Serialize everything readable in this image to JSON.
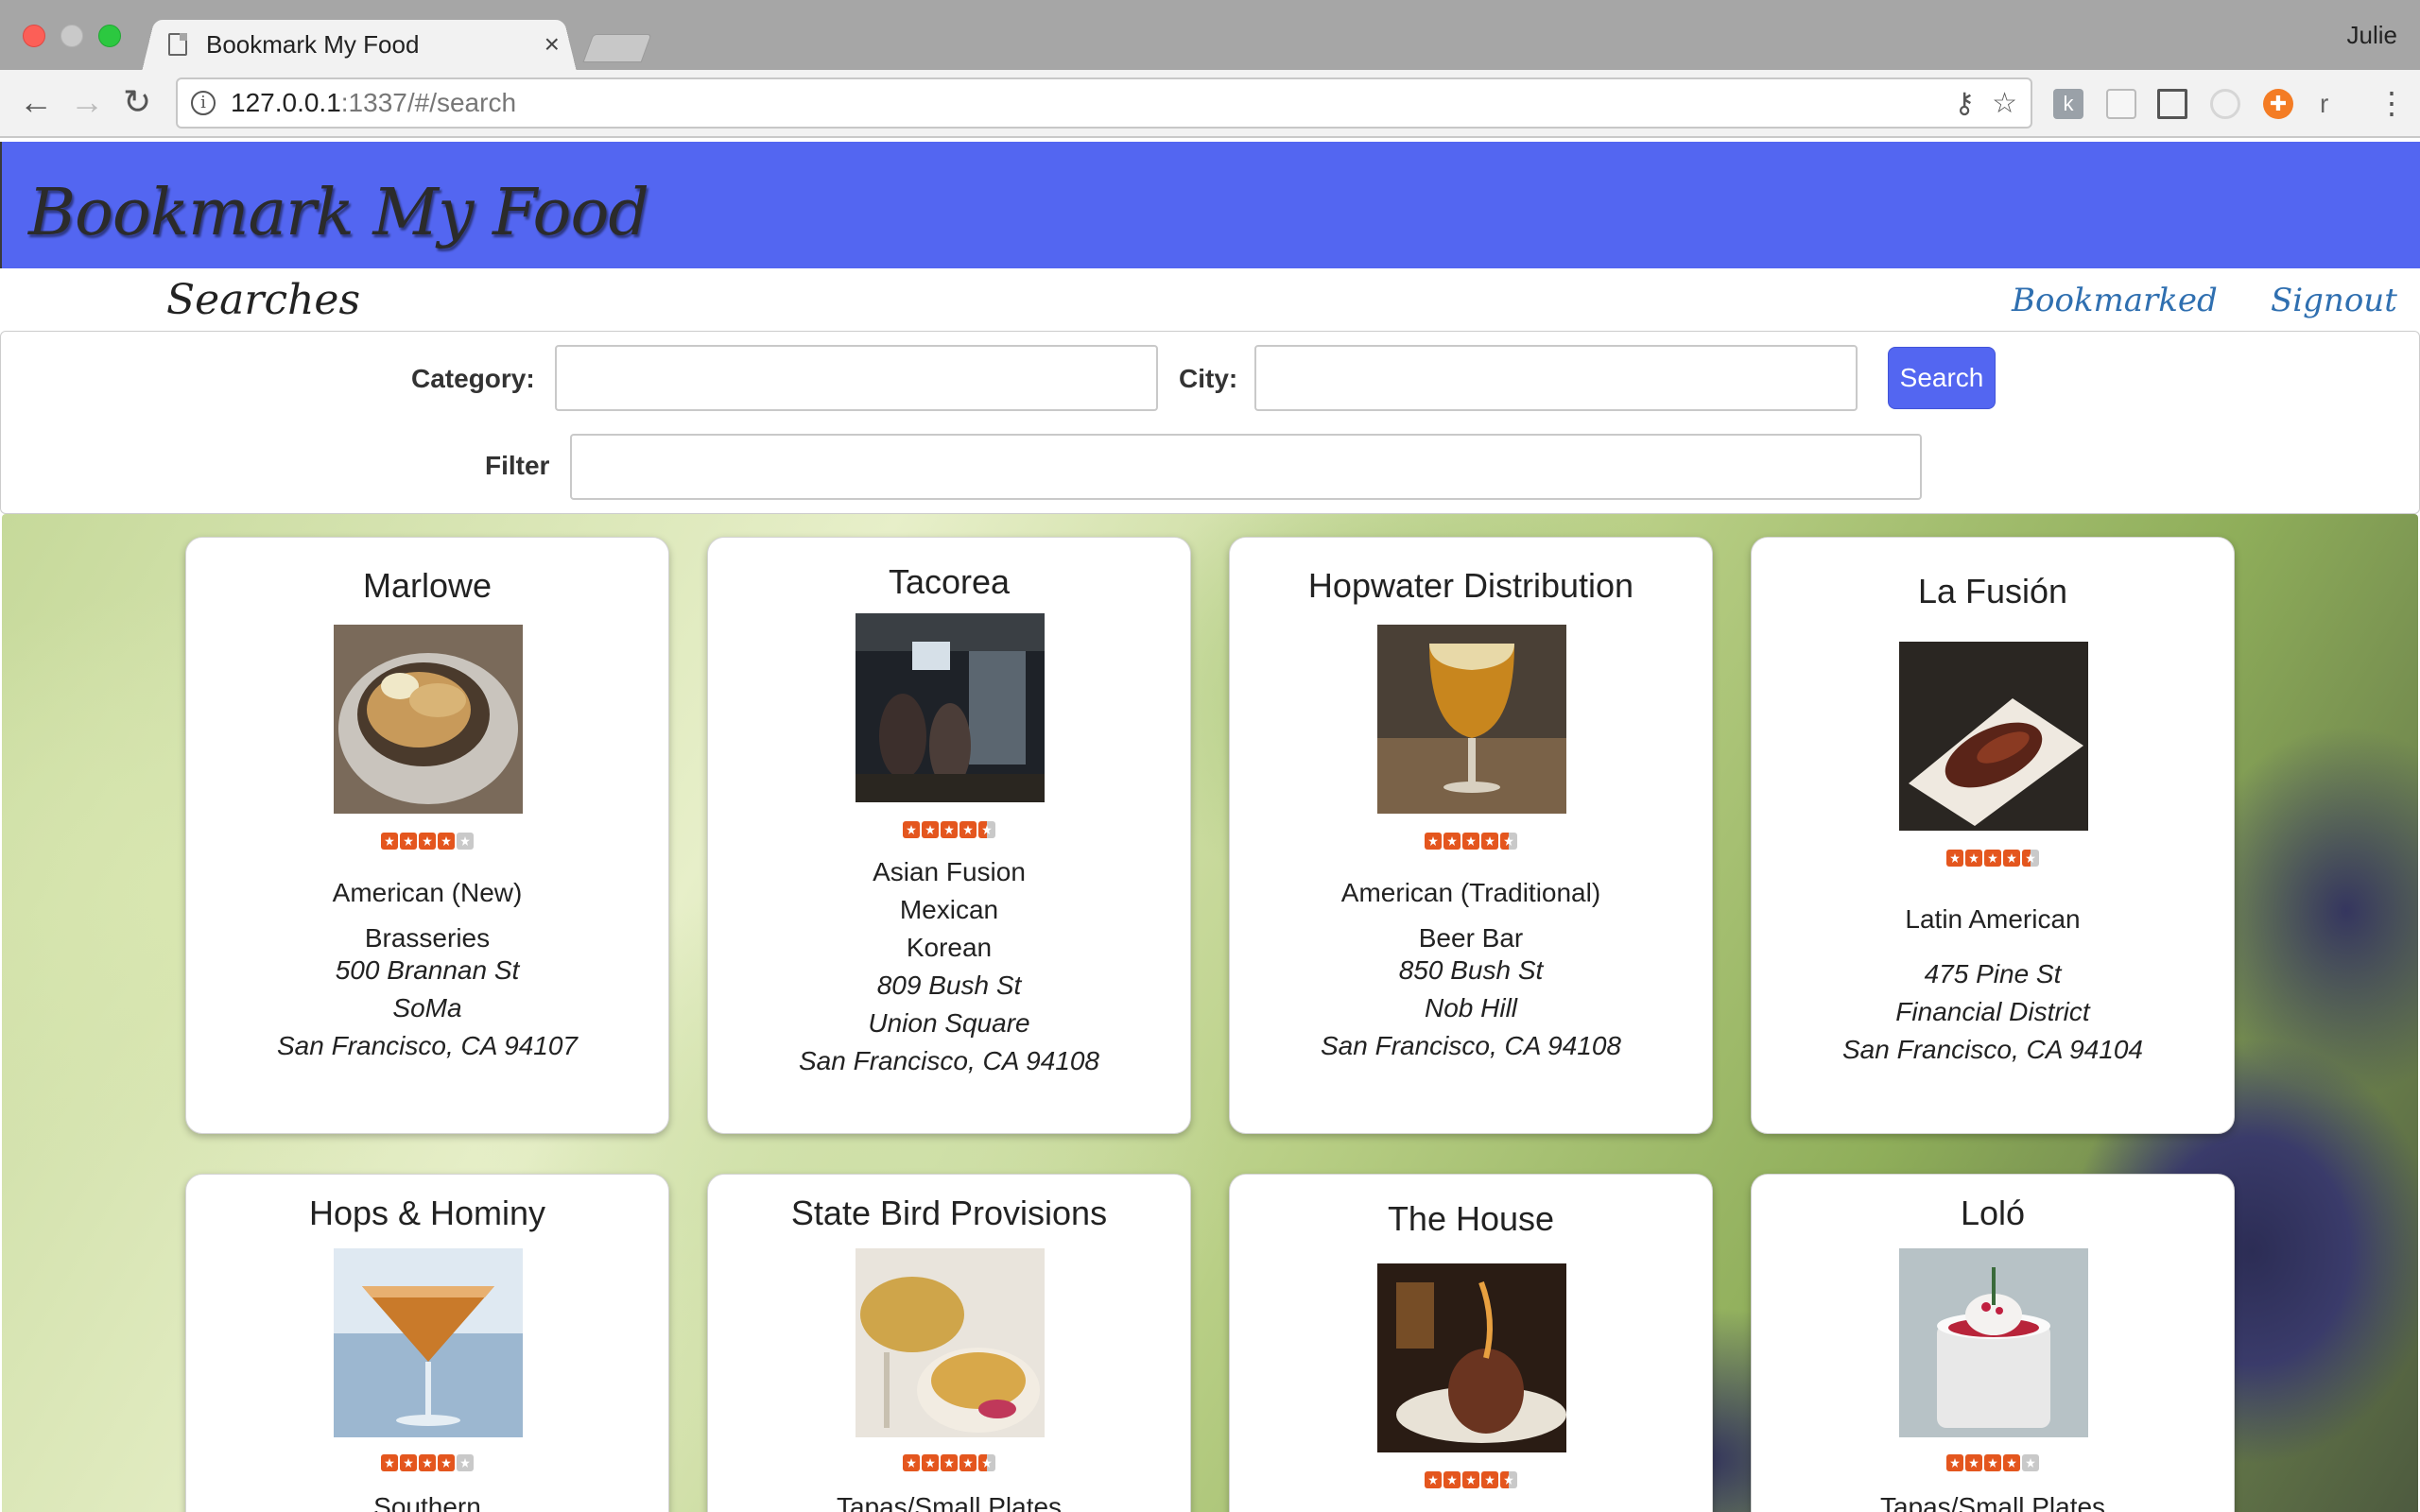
{
  "browser": {
    "tab_title": "Bookmark My Food",
    "profile_name": "Julie",
    "url_host": "127.0.0.1",
    "url_rest": ":1337/#/search"
  },
  "app": {
    "brand": "Bookmark My Food",
    "section_title": "Searches",
    "nav": {
      "bookmarked": "Bookmarked",
      "signout": "Signout"
    }
  },
  "search_form": {
    "category_label": "Category:",
    "category_value": "",
    "city_label": "City:",
    "city_value": "",
    "search_button": "Search",
    "filter_label": "Filter",
    "filter_value": ""
  },
  "results": [
    {
      "name": "Marlowe",
      "rating": 4,
      "categories": [
        "American (New)",
        "Brasseries"
      ],
      "address": [
        "500 Brannan St",
        "SoMa",
        "San Francisco, CA 94107"
      ]
    },
    {
      "name": "Tacorea",
      "rating": 4.5,
      "categories": [
        "Asian Fusion",
        "Mexican",
        "Korean"
      ],
      "address": [
        "809 Bush St",
        "Union Square",
        "San Francisco, CA 94108"
      ]
    },
    {
      "name": "Hopwater Distribution",
      "rating": 4.5,
      "categories": [
        "American (Traditional)",
        "Beer Bar"
      ],
      "address": [
        "850 Bush St",
        "Nob Hill",
        "San Francisco, CA 94108"
      ]
    },
    {
      "name": "La Fusión",
      "rating": 4.5,
      "categories": [
        "Latin American"
      ],
      "address": [
        "475 Pine St",
        "Financial District",
        "San Francisco, CA 94104"
      ]
    },
    {
      "name": "Hops & Hominy",
      "rating": 4,
      "categories": [
        "Southern"
      ],
      "address": []
    },
    {
      "name": "State Bird Provisions",
      "rating": 4.5,
      "categories": [
        "Tapas/Small Plates"
      ],
      "address": []
    },
    {
      "name": "The House",
      "rating": 4.5,
      "categories": [],
      "address": []
    },
    {
      "name": "Loló",
      "rating": 4,
      "categories": [
        "Tapas/Small Plates"
      ],
      "address": []
    }
  ],
  "colors": {
    "brand_blue": "#5366f1",
    "link_blue": "#2f6fb0",
    "star_orange": "#e4561e"
  },
  "icons": [
    "back-arrow-icon",
    "forward-arrow-icon",
    "reload-icon",
    "info-icon",
    "key-icon",
    "star-bookmark-icon",
    "cast-icon",
    "kebab-menu-icon"
  ]
}
